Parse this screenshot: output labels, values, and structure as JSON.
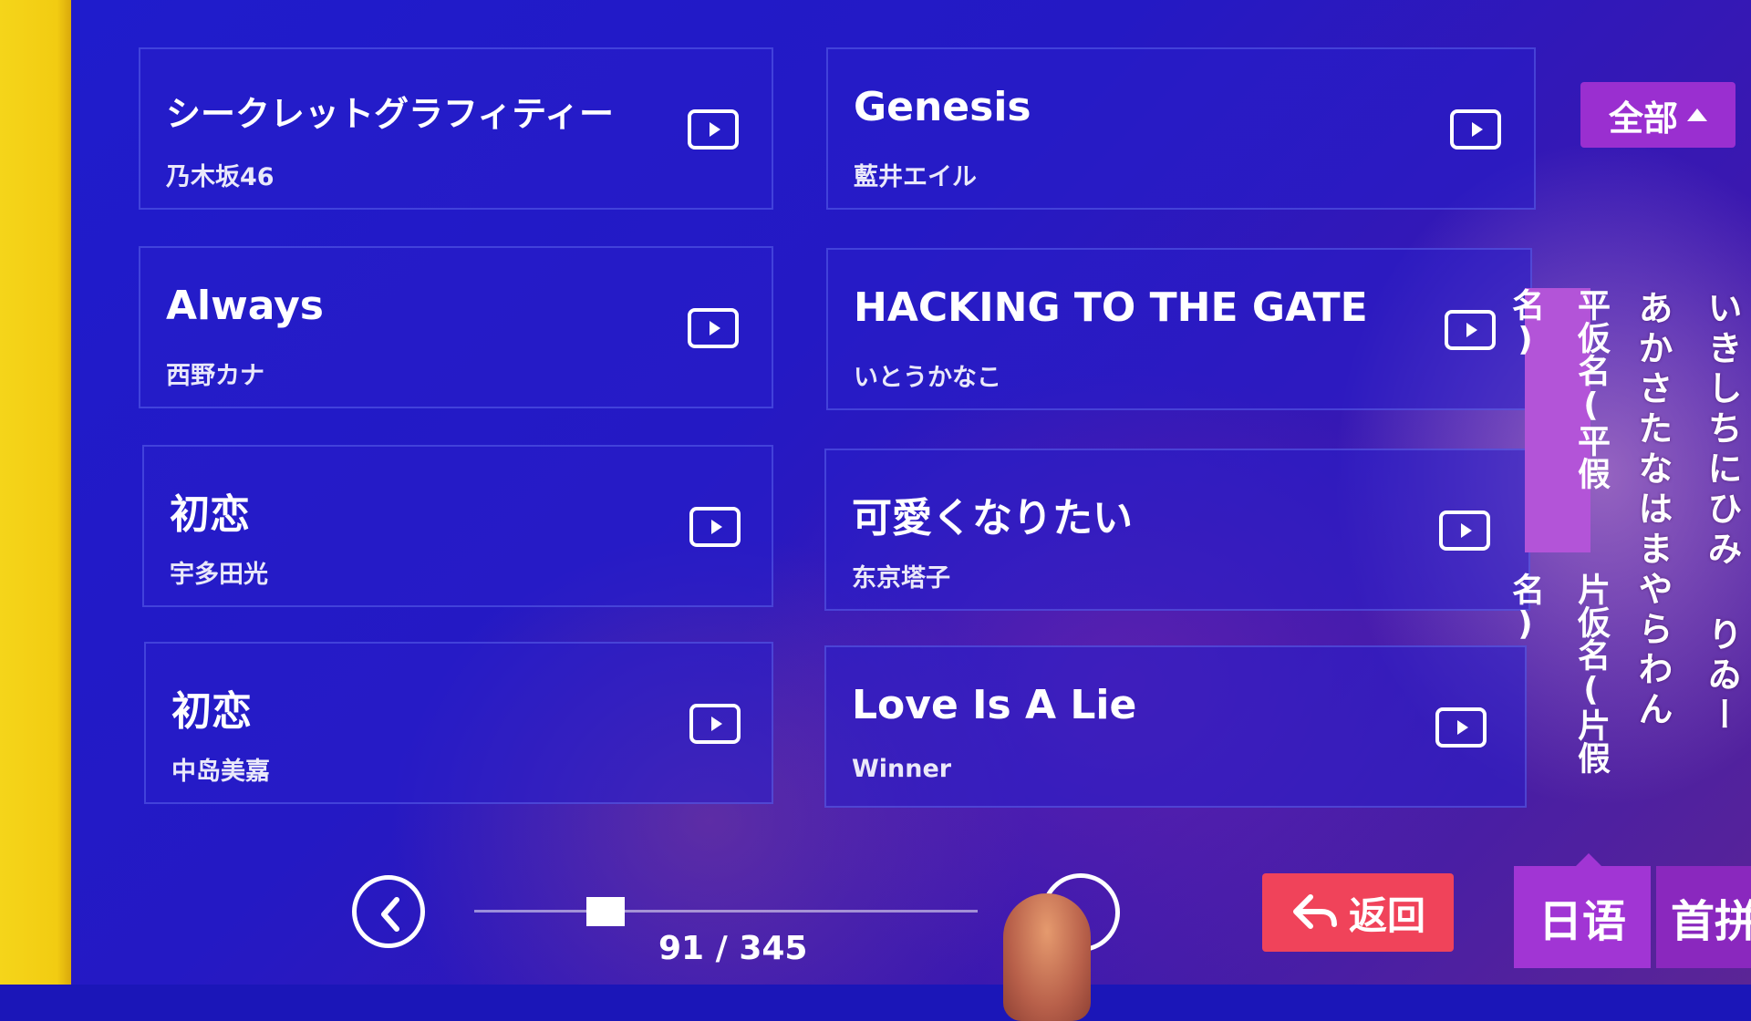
{
  "top_tabs": [
    "",
    "",
    "",
    "",
    "",
    "",
    ""
  ],
  "filter_button": {
    "label": "全部"
  },
  "songs": [
    {
      "title": "シークレットグラフィティー",
      "artist": "乃木坂46"
    },
    {
      "title": "Genesis",
      "artist": "藍井エイル"
    },
    {
      "title": "Always",
      "artist": "西野カナ"
    },
    {
      "title": "HACKING TO THE GATE",
      "artist": "いとうかなこ"
    },
    {
      "title": "初恋",
      "artist": "宇多田光"
    },
    {
      "title": "可愛くなりたい",
      "artist": "东京塔子"
    },
    {
      "title": "初恋",
      "artist": "中岛美嘉"
    },
    {
      "title": "Love Is A Lie",
      "artist": "Winner"
    }
  ],
  "kana_tabs": [
    {
      "label": "平仮名(平假名)",
      "active": true
    },
    {
      "label": "片仮名(片假名)",
      "active": false
    }
  ],
  "kana_columns": [
    "あかさたなはまやらわん",
    "いきしちにひみ りゐー"
  ],
  "pagination": {
    "current": "91",
    "total": "345",
    "label": "91 / 345",
    "fraction": 0.26
  },
  "back_button": {
    "label": "返回"
  },
  "language_tabs": [
    {
      "label": "日语",
      "active": true
    },
    {
      "label": "首拼",
      "active": false
    }
  ],
  "colors": {
    "accent": "#9a2fd0",
    "back": "#f0435a",
    "background": "#1b16b8",
    "active_tab": "#ffd21e"
  }
}
